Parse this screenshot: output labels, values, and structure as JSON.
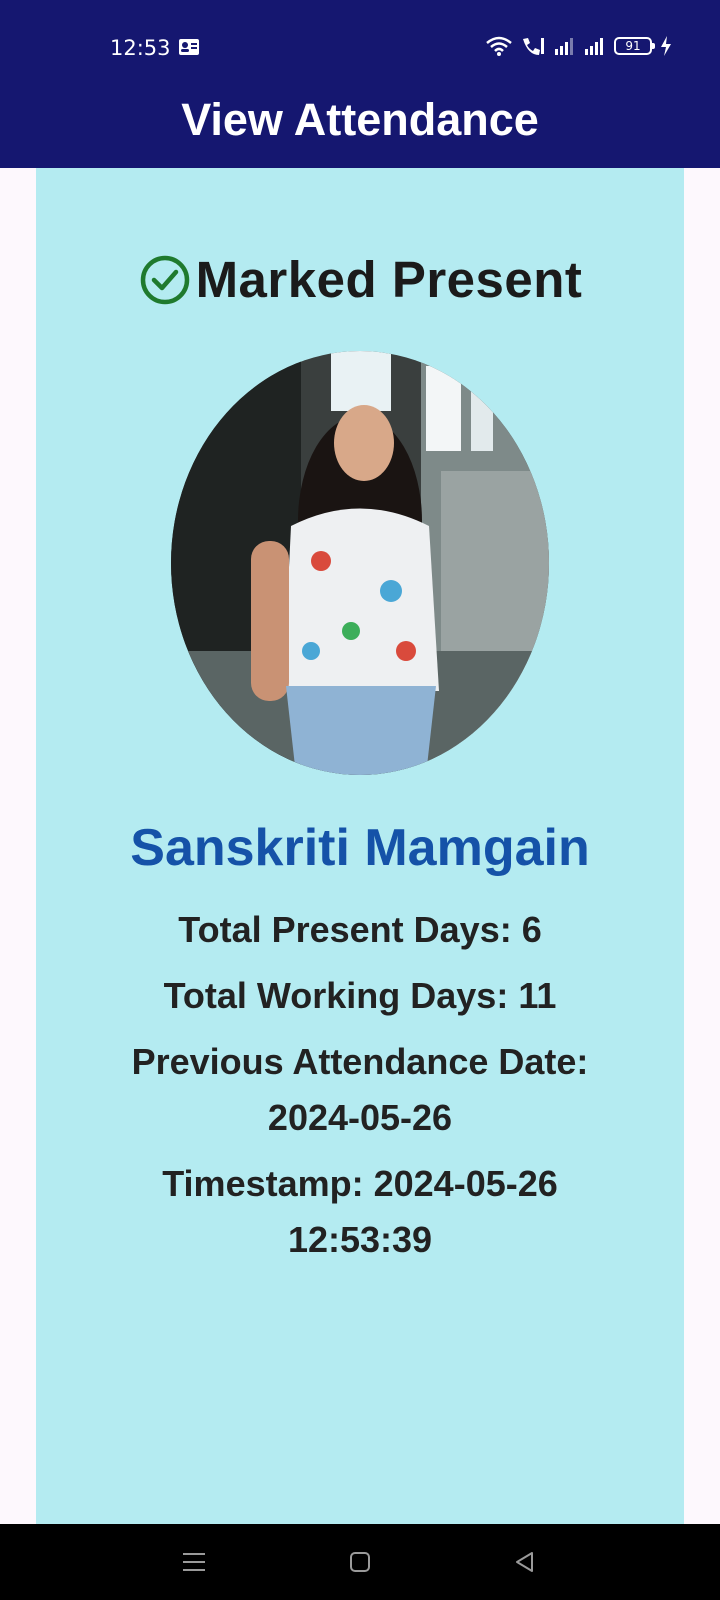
{
  "status_bar": {
    "time": "12:53",
    "battery": "91",
    "icons": [
      "contact-card-icon",
      "wifi-icon",
      "volte-call-icon",
      "signal-icon",
      "signal-icon",
      "battery-icon",
      "charging-icon"
    ]
  },
  "app_bar": {
    "title": "View Attendance"
  },
  "attendance": {
    "status_label": "Marked Present",
    "name": "Sanskriti Mamgain",
    "total_present": "Total Present Days: 6",
    "total_working": "Total Working Days: 11",
    "previous_label": "Previous Attendance Date:",
    "previous_date": "2024-05-26",
    "timestamp_label": "Timestamp: 2024-05-26",
    "timestamp_time": "12:53:39"
  },
  "colors": {
    "app_bar": "#151770",
    "card": "#b4ebf1",
    "name": "#1552a8",
    "check": "#1f7a2e"
  },
  "nav_bar": {
    "buttons": [
      "menu-icon",
      "home-square-icon",
      "back-triangle-icon"
    ]
  }
}
